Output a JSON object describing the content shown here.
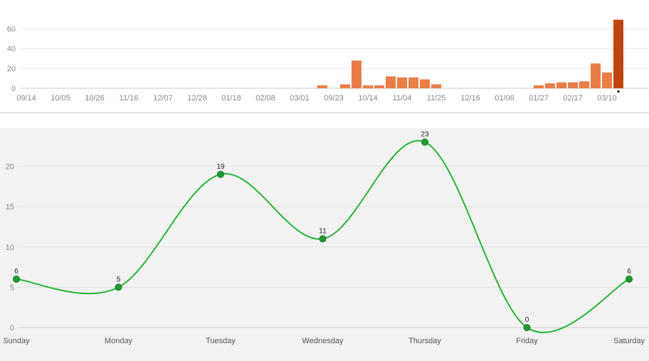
{
  "chart_data": [
    {
      "type": "bar",
      "categories": [
        "09/14",
        "",
        "",
        "10/05",
        "",
        "",
        "10/26",
        "",
        "",
        "11/16",
        "",
        "",
        "12/07",
        "",
        "",
        "12/28",
        "",
        "",
        "01/18",
        "",
        "",
        "02/08",
        "",
        "",
        "03/01",
        "",
        "",
        "09/23",
        "",
        "",
        "10/14",
        "",
        "",
        "11/04",
        "",
        "",
        "11/25",
        "",
        "",
        "12/16",
        "",
        "",
        "01/06",
        "",
        "",
        "01/27",
        "",
        "",
        "02/17",
        "",
        "",
        "03/10"
      ],
      "values": [
        0,
        0,
        0,
        0,
        0,
        0,
        0,
        0,
        0,
        0,
        0,
        0,
        0,
        0,
        0,
        0,
        0,
        0,
        0,
        0,
        0,
        0,
        0,
        0,
        0,
        0,
        3,
        0,
        4,
        28,
        3,
        3,
        12,
        11,
        11,
        9,
        4,
        0,
        0,
        0,
        0,
        0,
        0,
        0,
        0,
        3,
        5,
        6,
        6,
        7,
        25,
        16,
        69
      ],
      "highlight_index": 52,
      "ylim": [
        0,
        72
      ],
      "yticks": [
        0,
        20,
        40,
        60
      ],
      "colors": {
        "bar": "#ed7d47",
        "highlight": "#c1440e"
      },
      "grid": true
    },
    {
      "type": "line",
      "categories": [
        "Sunday",
        "Monday",
        "Tuesday",
        "Wednesday",
        "Thursday",
        "Friday",
        "Saturday"
      ],
      "values": [
        6,
        5,
        19,
        11,
        23,
        0,
        6
      ],
      "ylim": [
        0,
        24
      ],
      "yticks": [
        0,
        5,
        10,
        15,
        20
      ],
      "colors": {
        "line": "#2bb13c",
        "marker": "#1e9a34",
        "marker_stroke": "#157a27"
      },
      "grid": true,
      "smooth": true
    }
  ]
}
